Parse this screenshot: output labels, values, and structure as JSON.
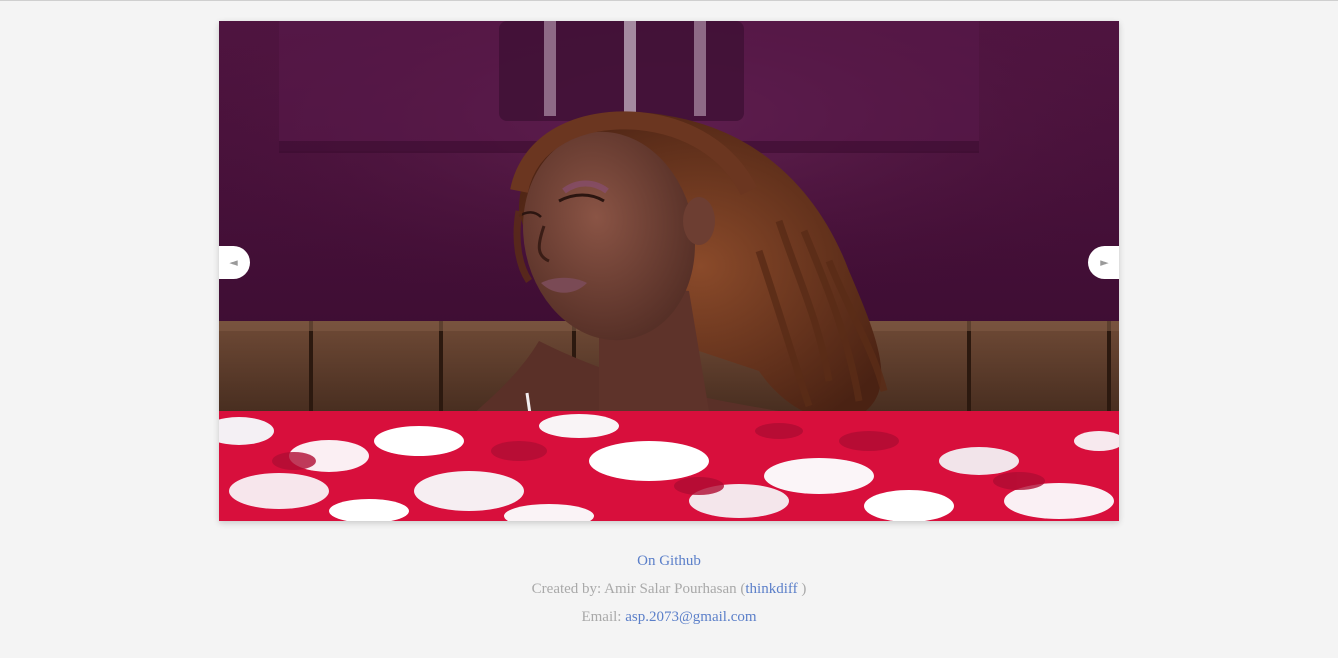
{
  "slider": {
    "prev_glyph": "◄",
    "next_glyph": "►",
    "prev_icon": "arrow-left-icon",
    "next_icon": "arrow-right-icon"
  },
  "footer": {
    "github_link": "On Github",
    "created_by_prefix": "Created by: Amir Salar Pourhasan (",
    "author_handle": "thinkdiff",
    "created_by_suffix": " )",
    "email_prefix": "Email: ",
    "email": "asp.2073@gmail.com"
  },
  "colors": {
    "background": "#f4f4f4",
    "link": "#5b7fc9",
    "muted_text": "#a9a9a9"
  }
}
